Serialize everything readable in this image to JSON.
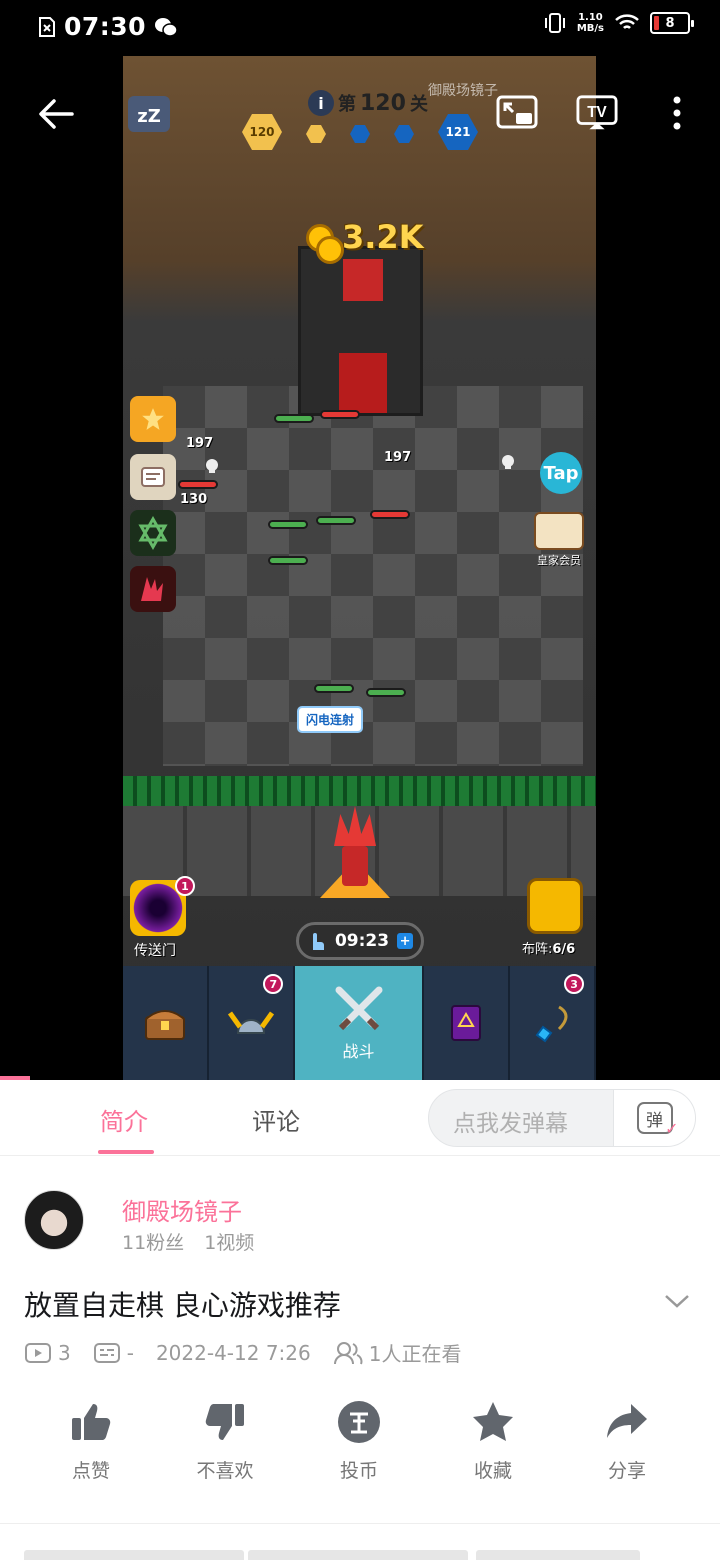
{
  "status_bar": {
    "time": "07:30",
    "net_speed_value": "1.10",
    "net_speed_unit": "MB/s",
    "battery": "8"
  },
  "game": {
    "level_prefix": "第",
    "level_number": "120",
    "level_suffix": "关",
    "watermark": "御殿场镜子",
    "hex_left": "120",
    "hex_right": "121",
    "coins": "3.2K",
    "hp_left": "197",
    "hp_right": "197",
    "hp_ally": "130",
    "tap_label": "Tap",
    "vip_label": "皇家会员",
    "skill_tip": "闪电连射",
    "portal_label": "传送门",
    "portal_badge": "1",
    "formation_label": "布阵:",
    "formation_value": "6/6",
    "timer": "09:23",
    "tabs": [
      {
        "name": "chest",
        "label": "",
        "badge": ""
      },
      {
        "name": "helmet",
        "label": "",
        "badge": "7"
      },
      {
        "name": "battle",
        "label": "战斗",
        "badge": ""
      },
      {
        "name": "book",
        "label": "",
        "badge": ""
      },
      {
        "name": "amulet",
        "label": "",
        "badge": "3"
      }
    ]
  },
  "sheet": {
    "tab_intro": "简介",
    "tab_comments": "评论",
    "danmaku_placeholder": "点我发弹幕",
    "danmaku_icon": "弹",
    "uploader": {
      "name": "御殿场镜子",
      "fans": "11粉丝",
      "videos": "1视频"
    },
    "title": "放置自走棋 良心游戏推荐",
    "meta": {
      "plays": "3",
      "danmaku_count": "-",
      "date": "2022-4-12 7:26",
      "watching": "1人正在看"
    },
    "actions": [
      {
        "name": "like",
        "label": "点赞"
      },
      {
        "name": "dislike",
        "label": "不喜欢"
      },
      {
        "name": "coin",
        "label": "投币"
      },
      {
        "name": "favorite",
        "label": "收藏"
      },
      {
        "name": "share",
        "label": "分享"
      }
    ]
  }
}
